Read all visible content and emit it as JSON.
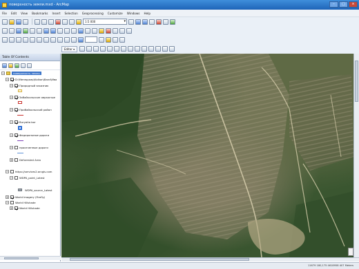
{
  "window": {
    "title": "поверхность земли.mxd - ArcMap"
  },
  "menu": [
    "File",
    "Edit",
    "View",
    "Bookmarks",
    "Insert",
    "Selection",
    "Geoprocessing",
    "Customize",
    "Windows",
    "Help"
  ],
  "toolbar": {
    "scale": "1:5 000",
    "editor_label": "Editor ▾"
  },
  "toc": {
    "title": "Table Of Contents",
    "layers": [
      {
        "label": "поверхность земли"
      },
      {
        "label": "D:\\Менеджер\\Kalkan\\Band\\Ива"
      },
      {
        "label": "Природный заказник"
      },
      {
        "label": "Забайкальские овражные"
      },
      {
        "label": "Прибайкальский район"
      },
      {
        "label": "Buryatia bor"
      },
      {
        "label": "Федеральные дороги"
      },
      {
        "label": "просеченные дороги"
      },
      {
        "label": "Deforested Area"
      },
      {
        "label": "https://services2.arcgis.com"
      },
      {
        "label": "WDPA_point_Latest"
      },
      {
        "label": "WDPA_source_Latest"
      },
      {
        "label": "World Imagery (Firefly)"
      },
      {
        "label": "World Hillshade"
      },
      {
        "label": "World Hillshade"
      }
    ]
  },
  "status": {
    "coordinates": "11679 180,175  4618958 407 Meters"
  }
}
